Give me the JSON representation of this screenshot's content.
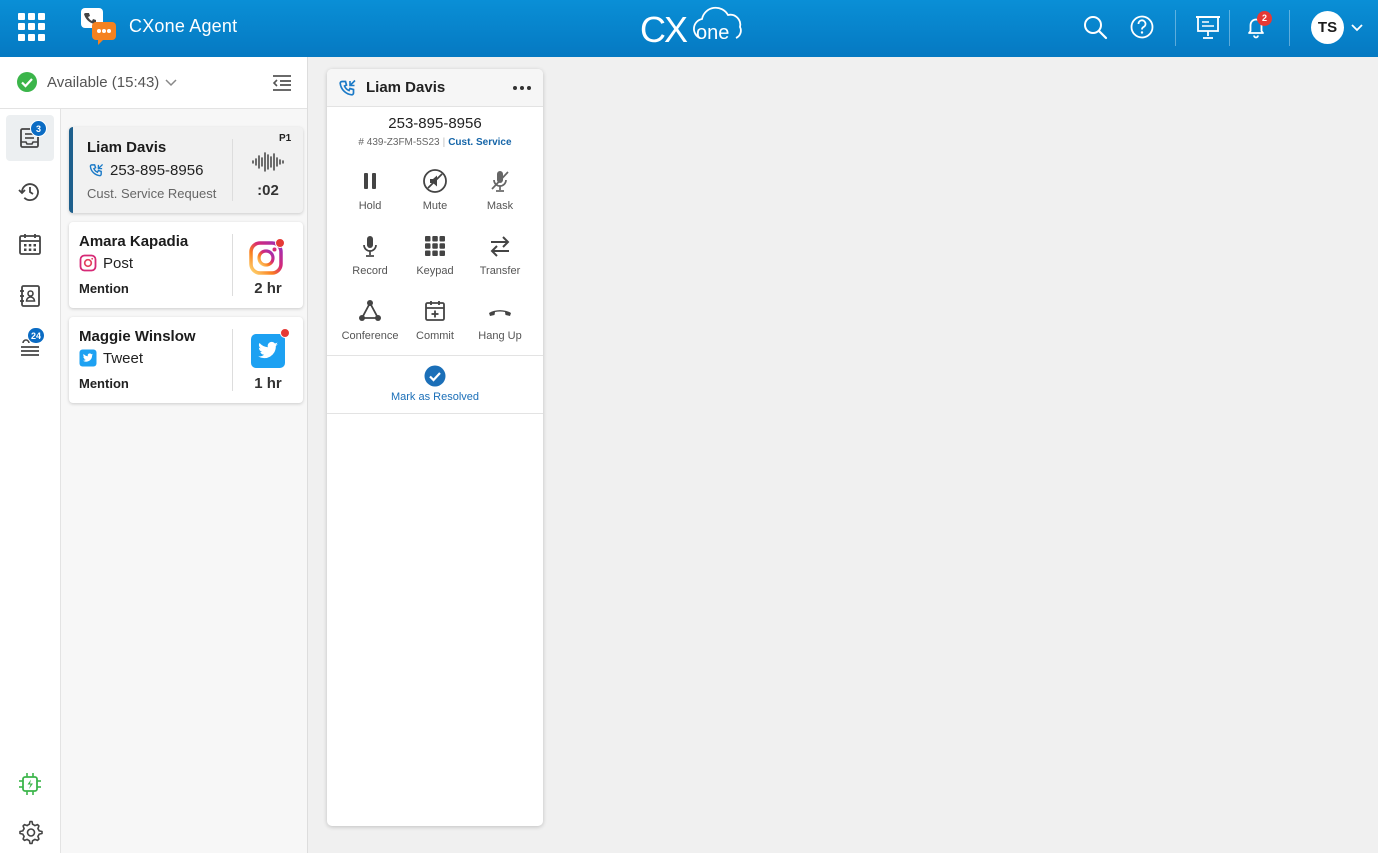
{
  "topbar": {
    "app_name": "CXone Agent",
    "brand": "CXone",
    "notification_count": "2",
    "user_initials": "TS",
    "accent_color": "#0a8fd6"
  },
  "status": {
    "label": "Available (15:43)",
    "color": "#3bb54a"
  },
  "nav": {
    "inbox_badge": "3",
    "queue_badge": "24"
  },
  "interactions": [
    {
      "name": "Liam Davis",
      "phone": "253-895-8956",
      "detail": "Cust. Service Request",
      "priority": "P1",
      "timer": ":02"
    },
    {
      "name": "Amara Kapadia",
      "channel": "Post",
      "detail": "Mention",
      "age": "2 hr"
    },
    {
      "name": "Maggie Winslow",
      "channel": "Tweet",
      "detail": "Mention",
      "age": "1 hr"
    }
  ],
  "call": {
    "title": "Liam Davis",
    "number": "253-895-8956",
    "case_id": "# 439-Z3FM-5S23",
    "skill": "Cust. Service",
    "controls": [
      "Hold",
      "Mute",
      "Mask",
      "Record",
      "Keypad",
      "Transfer",
      "Conference",
      "Commit",
      "Hang Up"
    ],
    "resolve_label": "Mark as Resolved"
  }
}
